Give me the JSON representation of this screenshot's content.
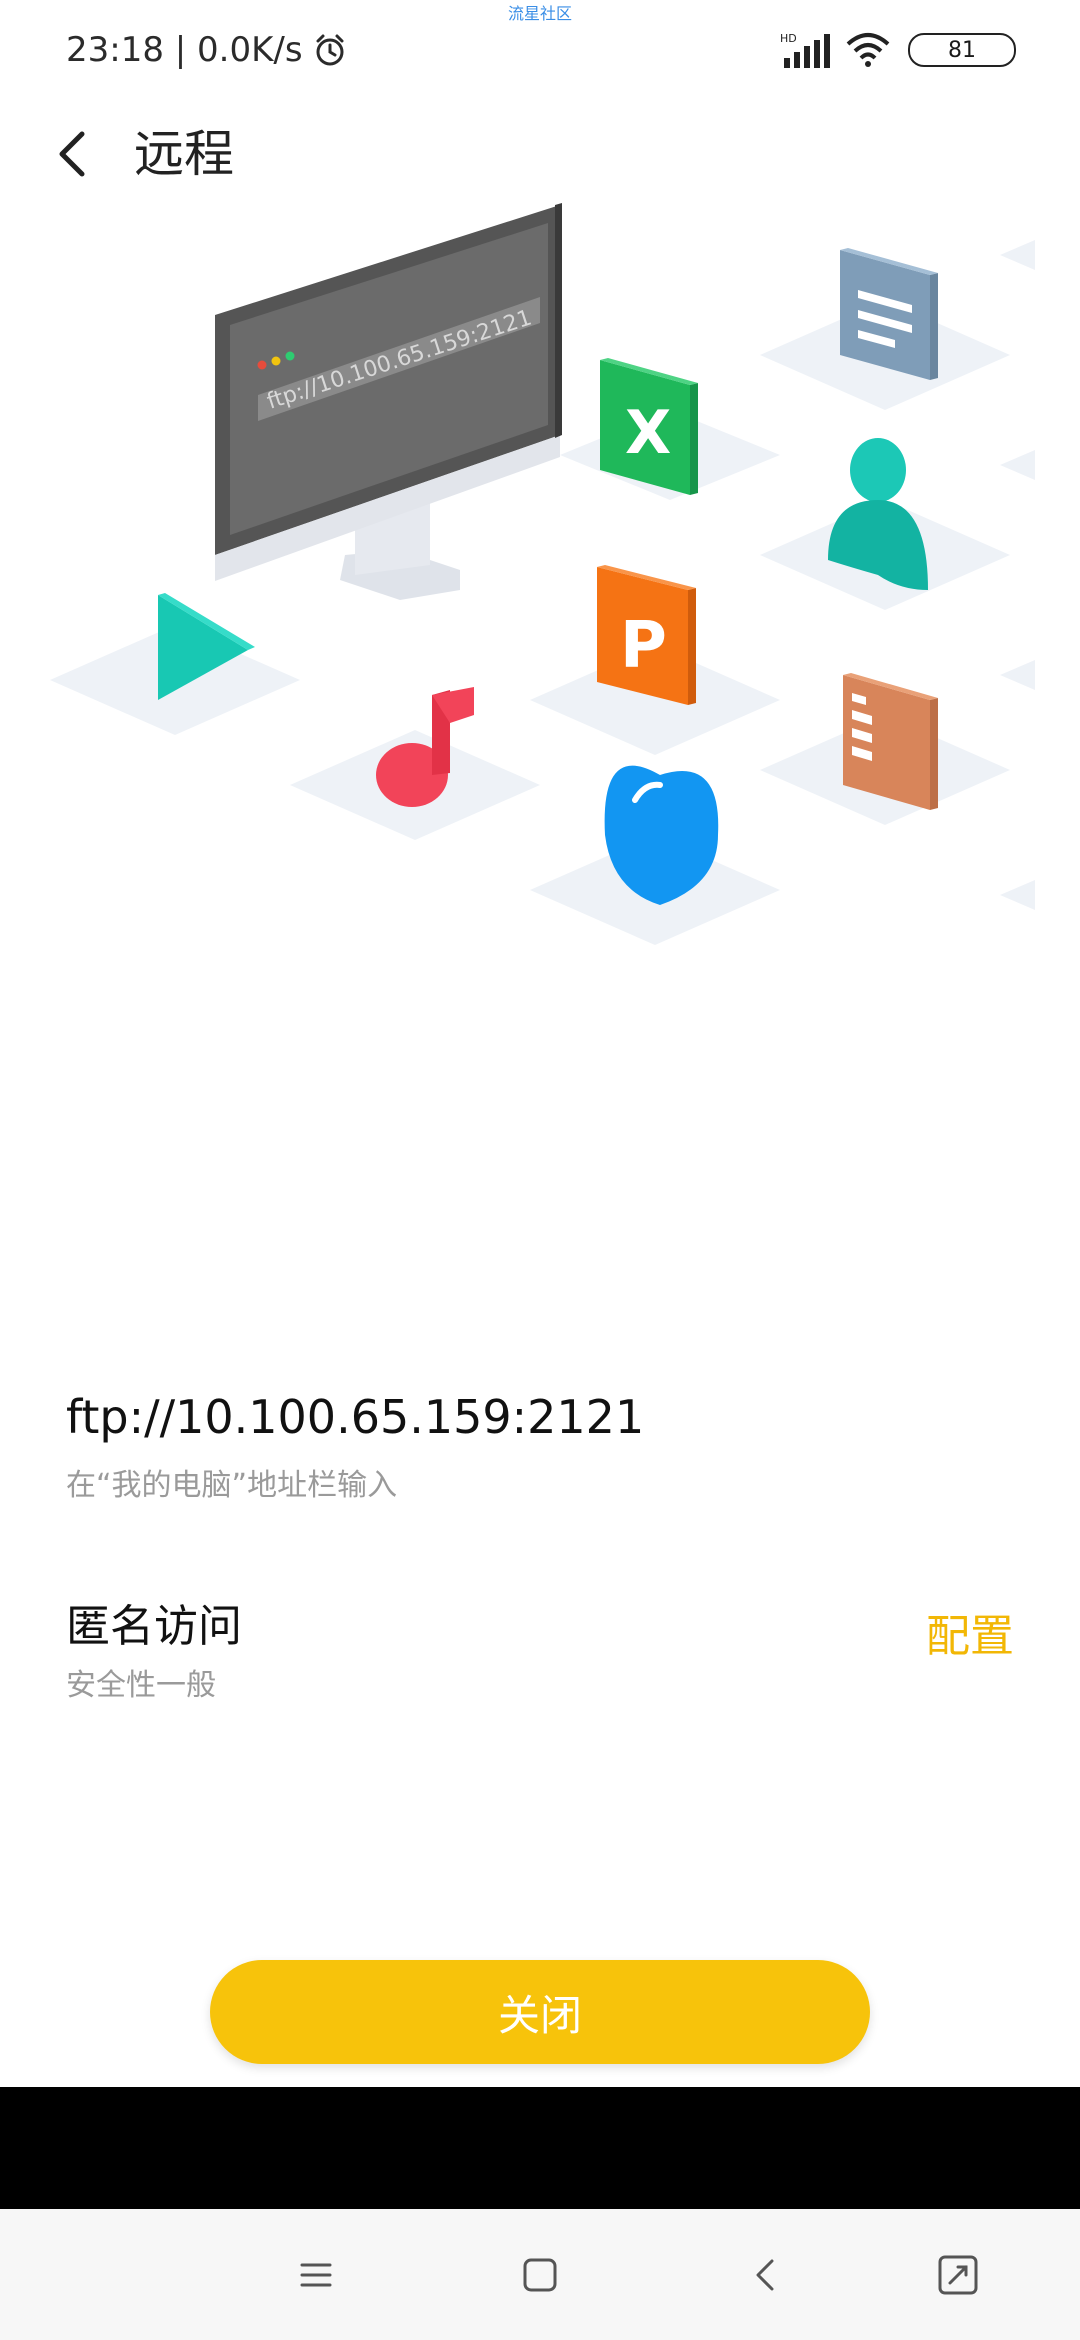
{
  "status_bar": {
    "watermark": "流星社区",
    "time_speed": "23:18 | 0.0K/s",
    "network_label": "HD",
    "battery": "81"
  },
  "header": {
    "title": "远程"
  },
  "illustration": {
    "monitor_url": "ftp://10.100.65.159:2121",
    "excel_letter": "X",
    "ppt_letter": "P"
  },
  "connection": {
    "url": "ftp://10.100.65.159:2121",
    "hint": "在“我的电脑”地址栏输入"
  },
  "access": {
    "title": "匿名访问",
    "subtitle": "安全性一般",
    "config_label": "配置"
  },
  "actions": {
    "close_label": "关闭"
  },
  "colors": {
    "accent": "#f7c30b",
    "config_text": "#f2b705"
  }
}
